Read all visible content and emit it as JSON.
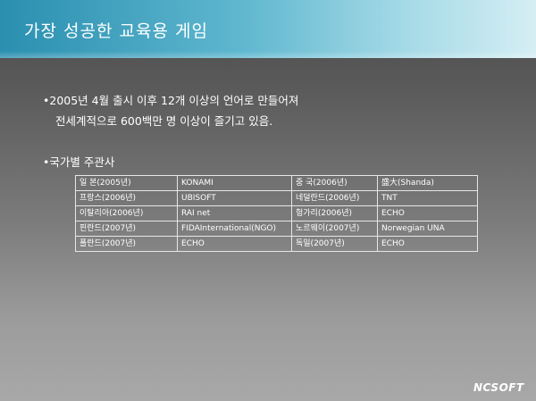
{
  "title": "가장 성공한 교육용 게임",
  "bullets": {
    "first_line1": "•2005년 4월 출시 이후 12개 이상의 언어로 만들어져",
    "first_line2": "전세계적으로 600백만 명 이상이 즐기고 있음.",
    "second": "•국가별 주관사"
  },
  "sponsor_table": {
    "rows": [
      [
        "일  본(2005년)",
        "KONAMI",
        "중  국(2006년)",
        "盛大(Shanda)"
      ],
      [
        "프랑스(2006년)",
        "UBISOFT",
        "네덜란드(2006년)",
        "TNT"
      ],
      [
        "이탈리아(2006년)",
        "RAI net",
        "헝가리(2006년)",
        "ECHO"
      ],
      [
        "핀란드(2007년)",
        "FIDAInternational(NGO)",
        "노르웨이(2007년)",
        "Norwegian UNA"
      ],
      [
        "폴란드(2007년)",
        "ECHO",
        "독일(2007년)",
        "ECHO"
      ]
    ]
  },
  "logo_text": "NCSOFT"
}
